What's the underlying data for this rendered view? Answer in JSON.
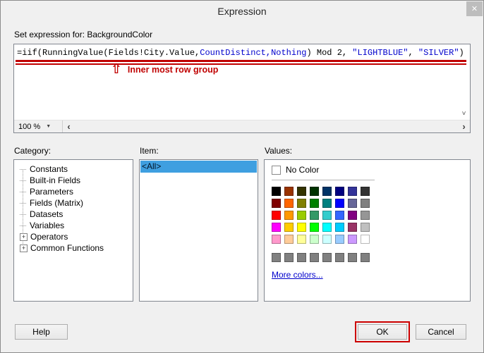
{
  "colors": {
    "annotation_red": "#c00000",
    "selection_blue": "#3f9fe0",
    "link_blue": "#0000cc",
    "syntax_blue": "#0000cc"
  },
  "icons": {
    "close": "✕",
    "dropdown": "▼",
    "chevron_left": "‹",
    "chevron_right": "›",
    "chevron_down": "˅"
  },
  "window": {
    "title": "Expression"
  },
  "expression_editor": {
    "label": "Set expression for: BackgroundColor",
    "zoom_value": "100 %",
    "segments": [
      {
        "text": "=iif(RunningValue(Fields!City.Value,",
        "color": "#000000"
      },
      {
        "text": "CountDistinct,Nothing",
        "color": "#0000cc"
      },
      {
        "text": ") Mod 2, ",
        "color": "#000000"
      },
      {
        "text": "\"LIGHTBLUE\"",
        "color": "#0000cc"
      },
      {
        "text": ", ",
        "color": "#000000"
      },
      {
        "text": "\"SILVER\"",
        "color": "#0000cc"
      },
      {
        "text": ")",
        "color": "#000000"
      }
    ],
    "annotation": {
      "arrow": "⇧",
      "text": "Inner most row group"
    }
  },
  "category_panel": {
    "label": "Category:",
    "items": [
      {
        "label": "Constants",
        "expandable": false
      },
      {
        "label": "Built-in Fields",
        "expandable": false
      },
      {
        "label": "Parameters",
        "expandable": false
      },
      {
        "label": "Fields (Matrix)",
        "expandable": false
      },
      {
        "label": "Datasets",
        "expandable": false
      },
      {
        "label": "Variables",
        "expandable": false
      },
      {
        "label": "Operators",
        "expandable": true
      },
      {
        "label": "Common Functions",
        "expandable": true
      }
    ]
  },
  "item_panel": {
    "label": "Item:",
    "items": [
      {
        "label": "<All>",
        "selected": true
      }
    ]
  },
  "values_panel": {
    "label": "Values:",
    "no_color_label": "No Color",
    "palette": [
      [
        "#000000",
        "#993300",
        "#333300",
        "#003300",
        "#003366",
        "#000080",
        "#333399",
        "#333333"
      ],
      [
        "#800000",
        "#FF6600",
        "#808000",
        "#008000",
        "#008080",
        "#0000FF",
        "#666699",
        "#808080"
      ],
      [
        "#FF0000",
        "#FF9900",
        "#99CC00",
        "#339966",
        "#33CCCC",
        "#3366FF",
        "#800080",
        "#969696"
      ],
      [
        "#FF00FF",
        "#FFCC00",
        "#FFFF00",
        "#00FF00",
        "#00FFFF",
        "#00CCFF",
        "#993366",
        "#C0C0C0"
      ],
      [
        "#FF99CC",
        "#FFCC99",
        "#FFFF99",
        "#CCFFCC",
        "#CCFFFF",
        "#99CCFF",
        "#CC99FF",
        "#FFFFFF"
      ]
    ],
    "grays": [
      "#808080",
      "#808080",
      "#808080",
      "#808080",
      "#808080",
      "#808080",
      "#808080",
      "#808080"
    ],
    "more_colors_label": "More colors..."
  },
  "buttons": {
    "help": "Help",
    "ok": "OK",
    "cancel": "Cancel"
  }
}
